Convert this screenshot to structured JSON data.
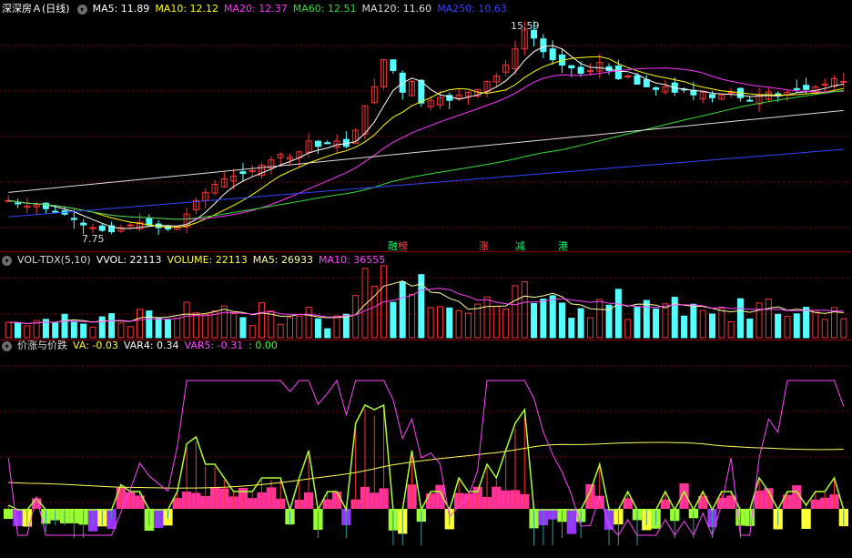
{
  "header_main": {
    "title": "深深房Ａ(日线)",
    "ma_items": [
      {
        "label": "MA5:",
        "value": "11.89",
        "color": "#ffffff"
      },
      {
        "label": "MA10:",
        "value": "12.12",
        "color": "#ffff00"
      },
      {
        "label": "MA20:",
        "value": "12.37",
        "color": "#ff33ff"
      },
      {
        "label": "MA60:",
        "value": "12.51",
        "color": "#33dd33"
      },
      {
        "label": "MA120:",
        "value": "11.60",
        "color": "#dddddd"
      },
      {
        "label": "MA250:",
        "value": "10.63",
        "color": "#3344ff"
      }
    ]
  },
  "header_vol": {
    "title": "VOL-TDX(5,10)",
    "items": [
      {
        "label": "VVOL:",
        "value": "22113",
        "color": "#ffffff"
      },
      {
        "label": "VOLUME:",
        "value": "22113",
        "color": "#ffff33"
      },
      {
        "label": "MA5:",
        "value": "26933",
        "color": "#ffff99"
      },
      {
        "label": "MA10:",
        "value": "36555",
        "color": "#ff44ff"
      }
    ]
  },
  "header_ind": {
    "title": "价涨与价跌",
    "items": [
      {
        "label": "VA:",
        "value": "-0.03",
        "color": "#ffff33"
      },
      {
        "label": "VAR4:",
        "value": "0.34",
        "color": "#ffffff"
      },
      {
        "label": "VAR5:",
        "value": "-0.31",
        "color": "#ff44ff"
      },
      {
        "label": ":",
        "value": "0.00",
        "color": "#33ff33"
      }
    ]
  },
  "annotations": {
    "high": "15.59",
    "low": "7.75"
  },
  "markers": [
    {
      "text": "融",
      "color": "#00ff66"
    },
    {
      "text": "榜",
      "color": "#ff4444"
    },
    {
      "text": "涨",
      "color": "#ff4444"
    },
    {
      "text": "减",
      "color": "#00ff66"
    },
    {
      "text": "港",
      "color": "#00ff66"
    }
  ],
  "colors": {
    "up": "#ff3333",
    "down": "#54ffff",
    "grid": "#8a0000"
  },
  "chart_data": [
    {
      "type": "candlestick",
      "panel": "price",
      "bar_count": 90,
      "price_range": [
        7.75,
        15.59
      ],
      "closes": [
        9.0,
        8.9,
        8.8,
        8.85,
        8.7,
        8.6,
        8.5,
        8.3,
        8.1,
        8.0,
        7.9,
        7.85,
        8.0,
        8.1,
        8.2,
        8.1,
        8.0,
        7.95,
        8.05,
        8.5,
        9.0,
        9.3,
        9.6,
        9.8,
        9.9,
        10.0,
        10.1,
        10.3,
        10.5,
        10.7,
        10.6,
        10.8,
        11.2,
        11.0,
        11.1,
        11.2,
        11.0,
        11.6,
        12.5,
        13.2,
        14.2,
        13.8,
        13.0,
        13.4,
        12.6,
        12.7,
        12.8,
        12.7,
        12.9,
        13.0,
        13.1,
        13.4,
        13.6,
        14.0,
        14.6,
        15.3,
        15.0,
        14.5,
        14.2,
        14.0,
        13.9,
        13.7,
        13.8,
        14.1,
        13.8,
        13.5,
        13.6,
        13.3,
        13.2,
        13.1,
        13.2,
        13.0,
        13.1,
        12.9,
        13.0,
        12.8,
        12.9,
        13.0,
        12.8,
        12.7,
        12.9,
        13.0,
        12.9,
        13.0,
        13.1,
        13.1,
        13.2,
        13.3,
        13.5,
        13.4
      ],
      "ma_series": [
        "MA5",
        "MA10",
        "MA20",
        "MA60",
        "MA120",
        "MA250"
      ],
      "ma_last": [
        11.89,
        12.12,
        12.37,
        12.51,
        11.6,
        10.63
      ]
    },
    {
      "type": "bar",
      "panel": "volume",
      "series": [
        {
          "name": "VOLUME",
          "last": 22113
        },
        {
          "name": "MA5",
          "last": 26933
        },
        {
          "name": "MA10",
          "last": 36555
        }
      ]
    },
    {
      "type": "bar",
      "panel": "indicator",
      "series": [
        {
          "name": "VA",
          "last": -0.03
        },
        {
          "name": "VAR4",
          "last": 0.34
        },
        {
          "name": "VAR5",
          "last": -0.31
        }
      ]
    }
  ]
}
